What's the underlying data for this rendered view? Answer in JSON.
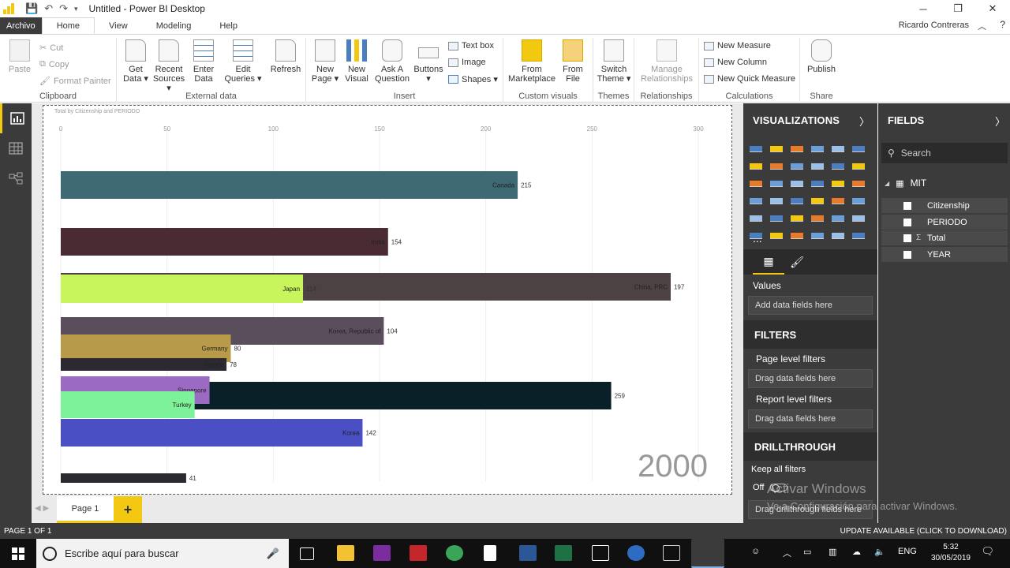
{
  "window": {
    "title": "Untitled - Power BI Desktop",
    "minimize": "─",
    "maximize": "❐",
    "close": "✕"
  },
  "tabs": [
    "Archivo",
    "Home",
    "View",
    "Modeling",
    "Help"
  ],
  "user": "Ricardo Contreras",
  "help_glyph": "?",
  "ribbon": {
    "clipboard": {
      "label": "Clipboard",
      "paste": "Paste",
      "cut": "Cut",
      "copy": "Copy",
      "format_painter": "Format Painter"
    },
    "external": {
      "label": "External data",
      "get_data": [
        "Get",
        "Data ▾"
      ],
      "recent_sources": [
        "Recent",
        "Sources ▾"
      ],
      "enter_data": [
        "Enter",
        "Data"
      ],
      "edit_queries": [
        "Edit",
        "Queries ▾"
      ],
      "refresh": "Refresh"
    },
    "insert": {
      "label": "Insert",
      "new_page": [
        "New",
        "Page ▾"
      ],
      "new_visual": [
        "New",
        "Visual"
      ],
      "ask_question": [
        "Ask A",
        "Question"
      ],
      "buttons": [
        "Buttons",
        "▾"
      ],
      "text_box": "Text box",
      "image": "Image",
      "shapes": "Shapes ▾"
    },
    "custom": {
      "label": "Custom visuals",
      "marketplace": [
        "From",
        "Marketplace"
      ],
      "from_file": [
        "From",
        "File"
      ]
    },
    "themes": {
      "label": "Themes",
      "switch": [
        "Switch",
        "Theme ▾"
      ]
    },
    "relationships": {
      "label": "Relationships",
      "manage": [
        "Manage",
        "Relationships"
      ]
    },
    "calculations": {
      "label": "Calculations",
      "new_measure": "New Measure",
      "new_column": "New Column",
      "new_quick_measure": "New Quick Measure"
    },
    "share": {
      "label": "Share",
      "publish": "Publish"
    }
  },
  "chart_data": {
    "type": "bar",
    "title": "Total by Citizenship and PERIODO",
    "xlim": [
      0,
      300
    ],
    "x_ticks": [
      0,
      50,
      100,
      150,
      200,
      250,
      300
    ],
    "period_label": "2000",
    "bars": [
      {
        "label": "Canada",
        "value": 215,
        "value_label": "215",
        "color": "#3e6a73"
      },
      {
        "label": "India",
        "value": 154,
        "value_label": "154",
        "color": "#4a2b33"
      },
      {
        "label": "China, PRC",
        "value": 287,
        "value_label": "197",
        "color": "#4c4244"
      },
      {
        "label": "Japan",
        "value": 114,
        "value_label": "114",
        "color": "#c8f45c"
      },
      {
        "label": "Korea, Republic of",
        "value": 152,
        "value_label": "104",
        "color": "#5a4e5c"
      },
      {
        "label": "Germany",
        "value": 80,
        "value_label": "80",
        "color": "#b89b4a"
      },
      {
        "label": "France",
        "value": 78,
        "value_label": "78",
        "color": "#2c2a30"
      },
      {
        "label": "",
        "value": 259,
        "value_label": "259",
        "color": "#0a2028"
      },
      {
        "label": "Singapore",
        "value": 70,
        "value_label": "",
        "color": "#9b6ac2"
      },
      {
        "label": "Turkey",
        "value": 63,
        "value_label": "",
        "color": "#7ef29a"
      },
      {
        "label": "Korea",
        "value": 142,
        "value_label": "142",
        "color": "#4a4fc4"
      },
      {
        "label": "",
        "value": 59,
        "value_label": "41",
        "color": "#2c2a30"
      }
    ]
  },
  "page_tabs": {
    "page1": "Page 1",
    "add": "+"
  },
  "visualizations": {
    "title": "VISUALIZATIONS",
    "more": "...",
    "values_label": "Values",
    "values_well": "Add data fields here",
    "filters_title": "FILTERS",
    "page_filters": "Page level filters",
    "page_filters_well": "Drag data fields here",
    "report_filters": "Report level filters",
    "report_filters_well": "Drag data fields here",
    "drill_title": "DRILLTHROUGH",
    "keep_all": "Keep all filters",
    "toggle_state": "Off",
    "drill_well": "Drag drillthrough fields here"
  },
  "fields": {
    "title": "FIELDS",
    "search_placeholder": "Search",
    "table": "MIT",
    "items": [
      {
        "name": "Citizenship",
        "sigma": ""
      },
      {
        "name": "PERIODO",
        "sigma": ""
      },
      {
        "name": "Total",
        "sigma": "Σ"
      },
      {
        "name": "YEAR",
        "sigma": ""
      }
    ]
  },
  "watermark": {
    "title": "Activar Windows",
    "subtitle": "Ve a Configuración para activar Windows."
  },
  "status": {
    "page": "PAGE 1 OF 1",
    "update": "UPDATE AVAILABLE (CLICK TO DOWNLOAD)"
  },
  "taskbar": {
    "search_placeholder": "Escribe aquí para buscar",
    "lang": "ENG",
    "time": "5:32",
    "date": "30/05/2019"
  },
  "colors": {
    "accent": "#f2c811",
    "pane_bg": "#3b3b3b"
  }
}
